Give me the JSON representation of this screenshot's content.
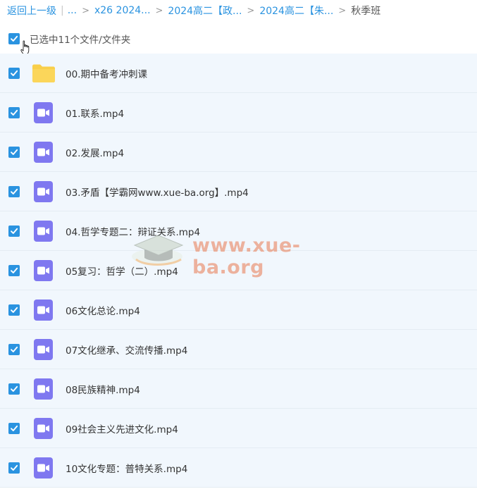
{
  "breadcrumb": {
    "back_label": "返回上一级",
    "separator": "|",
    "items": [
      {
        "label": "..."
      },
      {
        "label": "x26 2024..."
      },
      {
        "label": "2024高二【政..."
      },
      {
        "label": "2024高二【朱..."
      }
    ],
    "current": "秋季班"
  },
  "selection": {
    "summary_label": "已选中11个文件/文件夹",
    "all_checked": true
  },
  "files": [
    {
      "name": "00.期中备考冲刺课",
      "type": "folder",
      "checked": true
    },
    {
      "name": "01.联系.mp4",
      "type": "video",
      "checked": true
    },
    {
      "name": "02.发展.mp4",
      "type": "video",
      "checked": true
    },
    {
      "name": "03.矛盾【学霸网www.xue-ba.org】.mp4",
      "type": "video",
      "checked": true
    },
    {
      "name": "04.哲学专题二：辩证关系.mp4",
      "type": "video",
      "checked": true
    },
    {
      "name": "05复习：哲学（二）.mp4",
      "type": "video",
      "checked": true
    },
    {
      "name": "06文化总论.mp4",
      "type": "video",
      "checked": true
    },
    {
      "name": "07文化继承、交流传播.mp4",
      "type": "video",
      "checked": true
    },
    {
      "name": "08民族精神.mp4",
      "type": "video",
      "checked": true
    },
    {
      "name": "09社会主义先进文化.mp4",
      "type": "video",
      "checked": true
    },
    {
      "name": "10文化专题：普特关系.mp4",
      "type": "video",
      "checked": true
    }
  ],
  "watermark": {
    "text": "www.xue-ba.org"
  },
  "colors": {
    "accent": "#2a93e0",
    "video_icon": "#7f78f0",
    "folder": "#f9cf4a",
    "row_bg": "#f1f7fd"
  }
}
